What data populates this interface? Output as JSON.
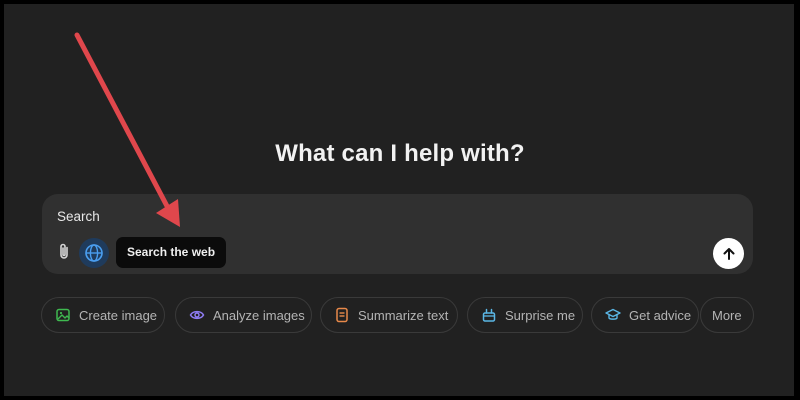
{
  "headline": "What can I help with?",
  "composer": {
    "input_text": "Search",
    "tooltip": "Search the web"
  },
  "icons": {
    "attach": "paperclip-icon",
    "web_search": "globe-icon",
    "send": "arrow-up-icon"
  },
  "suggestions": [
    {
      "label": "Create image",
      "icon": "image-icon",
      "color": "#3fb950"
    },
    {
      "label": "Analyze images",
      "icon": "eye-icon",
      "color": "#8e7cf2"
    },
    {
      "label": "Summarize text",
      "icon": "document-icon",
      "color": "#e8894a"
    },
    {
      "label": "Surprise me",
      "icon": "gift-icon",
      "color": "#5bb7e6"
    },
    {
      "label": "Get advice",
      "icon": "graduation-cap-icon",
      "color": "#5bb7e6"
    },
    {
      "label": "More",
      "icon": "",
      "color": "#b4b4b4"
    }
  ],
  "colors": {
    "background": "#212121",
    "composer": "#303030",
    "annotation_arrow": "#e0474c",
    "globe_active": "#4a9ef0"
  }
}
